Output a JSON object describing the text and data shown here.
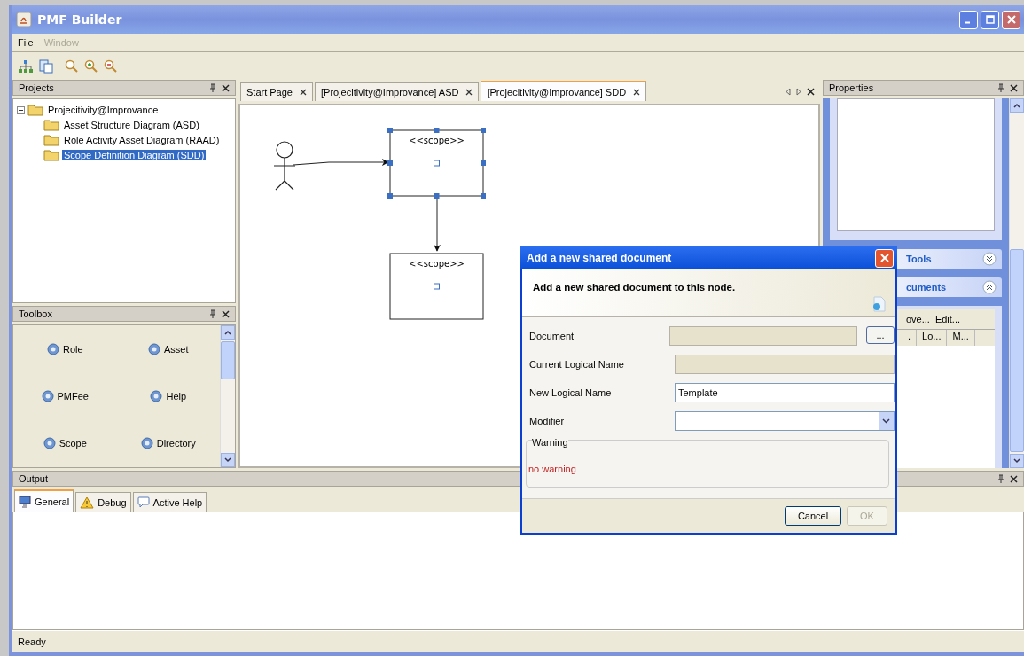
{
  "window": {
    "title": "PMF Builder"
  },
  "menu": [
    {
      "label": "File",
      "disabled": false
    },
    {
      "label": "Window",
      "disabled": true
    }
  ],
  "projects": {
    "title": "Projects",
    "tree": [
      {
        "label": "Projecitivity@Improvance",
        "expanded": true,
        "selected": false,
        "children": [
          {
            "label": "Asset Structure Diagram (ASD)",
            "selected": false
          },
          {
            "label": "Role Activity Asset Diagram (RAAD)",
            "selected": false
          },
          {
            "label": "Scope Definition Diagram (SDD)",
            "selected": true
          }
        ]
      }
    ]
  },
  "toolbox": {
    "title": "Toolbox",
    "items": [
      "Role",
      "Asset",
      "PMFee",
      "Help",
      "Scope",
      "Directory"
    ]
  },
  "editor": {
    "tabs": [
      {
        "label": "Start Page",
        "selected": false
      },
      {
        "label": "[Projecitivity@Improvance] ASD",
        "selected": false
      },
      {
        "label": "[Projecitivity@Improvance] SDD",
        "selected": true
      }
    ],
    "nodes": [
      {
        "stereotype": "<<scope>>",
        "selected": true
      },
      {
        "stereotype": "<<scope>>",
        "selected": false
      }
    ]
  },
  "properties": {
    "title": "Properties",
    "sections": [
      {
        "title": "Tools",
        "expanded": false
      },
      {
        "title": "cuments",
        "expanded": true
      }
    ],
    "actions": [
      "ove...",
      "Edit..."
    ],
    "columns": [
      ".",
      "Lo...",
      "M..."
    ]
  },
  "output": {
    "title": "Output",
    "tabs": [
      {
        "label": "General",
        "kind": "monitor",
        "selected": true
      },
      {
        "label": "Debug",
        "kind": "warning",
        "selected": false
      },
      {
        "label": "Active Help",
        "kind": "bubble",
        "selected": false
      }
    ]
  },
  "status_bar": "Ready",
  "dialog": {
    "title": "Add a new shared document",
    "header": "Add a new shared document to this node.",
    "fields": [
      {
        "label": "Document",
        "kind": "browse",
        "disabled": true,
        "button": "..."
      },
      {
        "label": "Current Logical Name",
        "kind": "text",
        "disabled": true
      },
      {
        "label": "New Logical Name",
        "kind": "text",
        "value": "Template",
        "disabled": false
      },
      {
        "label": "Modifier",
        "kind": "combo",
        "disabled": false
      }
    ],
    "warning_title": "Warning",
    "warning": "no warning",
    "buttons": [
      {
        "label": "Cancel",
        "disabled": false
      },
      {
        "label": "OK",
        "disabled": true
      }
    ]
  }
}
